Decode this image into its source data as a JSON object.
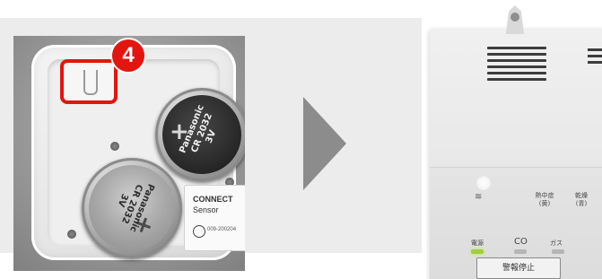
{
  "left_photo": {
    "step_number": "4",
    "battery_top": {
      "brand": "Panasonic",
      "model": "CR 2032",
      "voltage": "3V"
    },
    "battery_bottom": {
      "brand": "Panasonic",
      "model": "CR 2032",
      "voltage": "3V"
    },
    "sticker": {
      "line1": "CONNECT",
      "line2": "Sensor",
      "code": "009-200204"
    },
    "highlight_color": "#e3150f"
  },
  "arrow": {
    "color": "#8c8c8c",
    "direction": "right"
  },
  "right_photo": {
    "labels": {
      "heat_stroke": "熱中症\n(黄)",
      "dry": "乾燥\n(青)",
      "power": "電源",
      "co": "CO",
      "gas": "ガス"
    },
    "button_label": "警報停止",
    "power_led_color": "#9fd13c"
  }
}
